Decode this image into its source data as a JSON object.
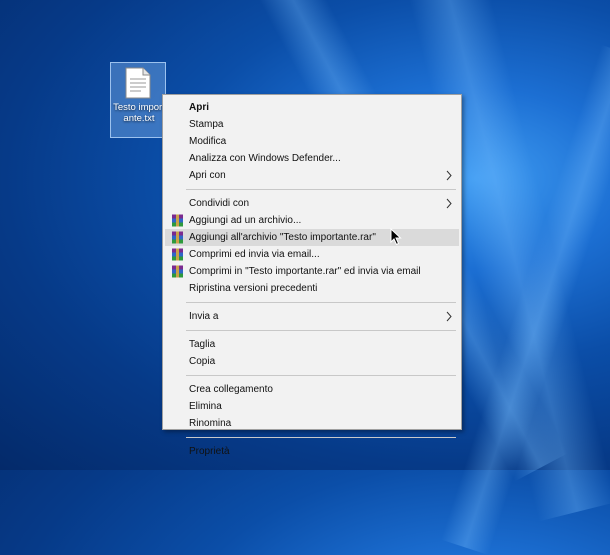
{
  "desktop": {
    "file_icon": "text-file-icon",
    "file_label": "Testo importante.txt"
  },
  "context_menu": {
    "groups": [
      [
        {
          "label": "Apri",
          "bold": true
        },
        {
          "label": "Stampa"
        },
        {
          "label": "Modifica"
        },
        {
          "label": "Analizza con Windows Defender..."
        },
        {
          "label": "Apri con",
          "submenu": true
        }
      ],
      [
        {
          "label": "Condividi con",
          "submenu": true
        },
        {
          "label": "Aggiungi ad un archivio...",
          "icon": "winrar-icon"
        },
        {
          "label": "Aggiungi all'archivio \"Testo importante.rar\"",
          "icon": "winrar-icon",
          "highlighted": true
        },
        {
          "label": "Comprimi ed invia via email...",
          "icon": "winrar-icon"
        },
        {
          "label": "Comprimi in \"Testo importante.rar\" ed invia via email",
          "icon": "winrar-icon"
        },
        {
          "label": "Ripristina versioni precedenti"
        }
      ],
      [
        {
          "label": "Invia a",
          "submenu": true
        }
      ],
      [
        {
          "label": "Taglia"
        },
        {
          "label": "Copia"
        }
      ],
      [
        {
          "label": "Crea collegamento"
        },
        {
          "label": "Elimina"
        },
        {
          "label": "Rinomina"
        }
      ],
      [
        {
          "label": "Proprietà"
        }
      ]
    ]
  },
  "colors": {
    "menu_bg": "#f2f2f2",
    "highlight": "#dadada",
    "separator": "#c8c8c8",
    "desktop_blue": "#0b4ea8"
  }
}
